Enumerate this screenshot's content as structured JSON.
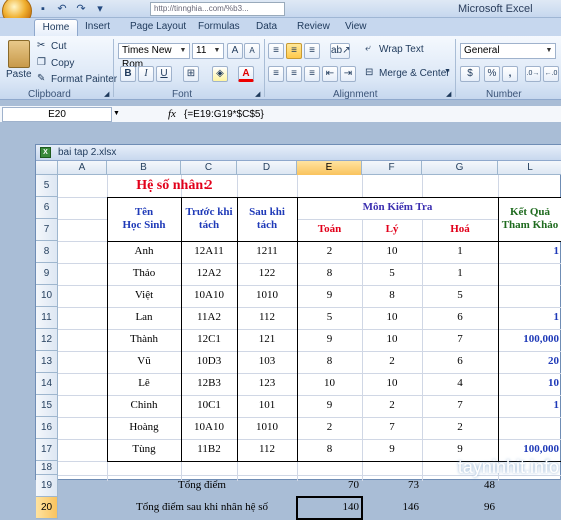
{
  "window": {
    "title": "Microsoft Excel",
    "url": "http://tinnghia...com/%b3..."
  },
  "tabs": [
    "Home",
    "Insert",
    "Page Layout",
    "Formulas",
    "Data",
    "Review",
    "View"
  ],
  "clipboard": {
    "paste": "Paste",
    "cut": "Cut",
    "copy": "Copy",
    "format_painter": "Format Painter",
    "label": "Clipboard"
  },
  "font": {
    "name": "Times New Rom",
    "size": "11",
    "label": "Font",
    "bold": "B",
    "italic": "I",
    "underline": "U"
  },
  "alignment": {
    "wrap": "Wrap Text",
    "merge": "Merge & Center",
    "label": "Alignment"
  },
  "number": {
    "format": "General",
    "label": "Number",
    "currency": "$",
    "percent": "%",
    "comma": ","
  },
  "formula_bar": {
    "name_box": "E20",
    "fx": "fx",
    "formula": "{=E19:G19*$C$5}"
  },
  "workbook": {
    "name": "bai tap 2.xlsx"
  },
  "columns": [
    "A",
    "B",
    "C",
    "D",
    "E",
    "F",
    "G",
    "L"
  ],
  "rows": [
    "5",
    "6",
    "7",
    "8",
    "9",
    "10",
    "11",
    "12",
    "13",
    "14",
    "15",
    "16",
    "17",
    "18",
    "19",
    "20"
  ],
  "sheet": {
    "multiplier_label": "Hệ số nhân:",
    "multiplier_value": "2",
    "hdr_name": "Tên\nHọc Sinh",
    "hdr_before": "Trước khi\ntách",
    "hdr_after": "Sau khi\ntách",
    "hdr_subjects": "Môn Kiểm Tra",
    "hdr_math": "Toán",
    "hdr_physics": "Lý",
    "hdr_chem": "Hoá",
    "hdr_result": "Kết Quả\nTham Khảo",
    "students": [
      {
        "name": "Anh",
        "before": "12A11",
        "after": "1211",
        "math": "2",
        "phys": "10",
        "chem": "1",
        "result": "1"
      },
      {
        "name": "Thảo",
        "before": "12A2",
        "after": "122",
        "math": "8",
        "phys": "5",
        "chem": "1",
        "result": ""
      },
      {
        "name": "Việt",
        "before": "10A10",
        "after": "1010",
        "math": "9",
        "phys": "8",
        "chem": "5",
        "result": ""
      },
      {
        "name": "Lan",
        "before": "11A2",
        "after": "112",
        "math": "5",
        "phys": "10",
        "chem": "6",
        "result": "1"
      },
      {
        "name": "Thành",
        "before": "12C1",
        "after": "121",
        "math": "9",
        "phys": "10",
        "chem": "7",
        "result": "100,000"
      },
      {
        "name": "Vũ",
        "before": "10D3",
        "after": "103",
        "math": "8",
        "phys": "2",
        "chem": "6",
        "result": "20"
      },
      {
        "name": "Lê",
        "before": "12B3",
        "after": "123",
        "math": "10",
        "phys": "10",
        "chem": "4",
        "result": "10"
      },
      {
        "name": "Chinh",
        "before": "10C1",
        "after": "101",
        "math": "9",
        "phys": "2",
        "chem": "7",
        "result": "1"
      },
      {
        "name": "Hoàng",
        "before": "10A10",
        "after": "1010",
        "math": "2",
        "phys": "7",
        "chem": "2",
        "result": ""
      },
      {
        "name": "Tùng",
        "before": "11B2",
        "after": "112",
        "math": "8",
        "phys": "9",
        "chem": "9",
        "result": "100,000"
      }
    ],
    "total_label": "Tổng điểm",
    "totals": [
      "70",
      "73",
      "48"
    ],
    "total2_label": "Tổng điểm sau khi nhân hệ số",
    "totals2": [
      "140",
      "146",
      "96"
    ]
  },
  "watermark": "tayninhit.info"
}
